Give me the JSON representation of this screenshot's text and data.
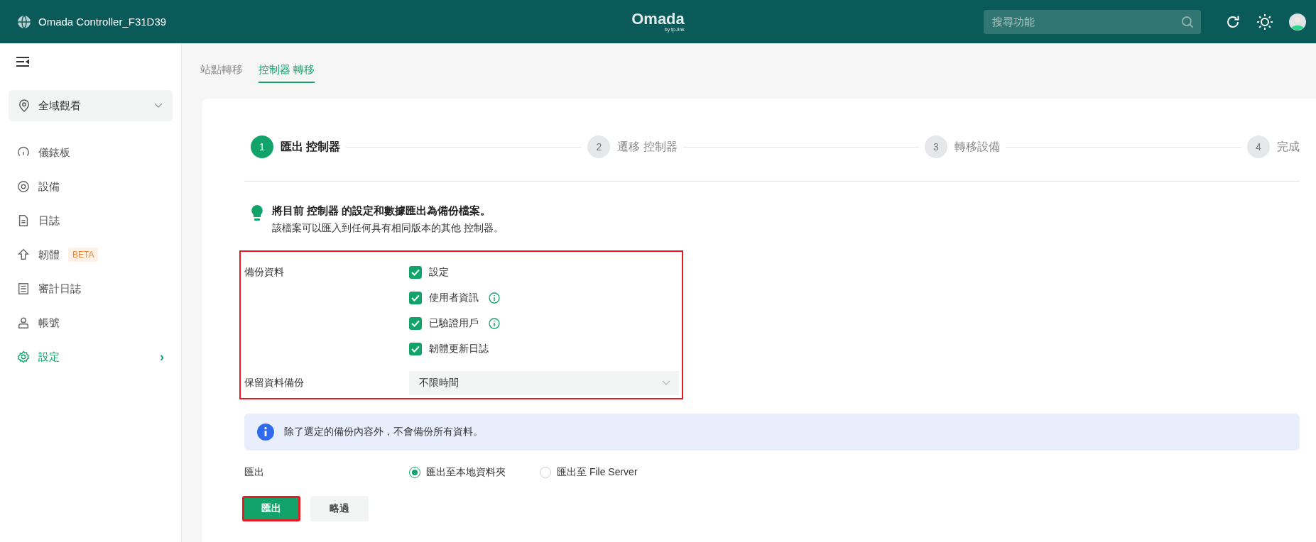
{
  "header": {
    "title": "Omada Controller_F31D39",
    "logo": "Omada",
    "logo_sub": "by tp-link",
    "search": {
      "placeholder": "搜尋功能"
    }
  },
  "sidebar": {
    "site_select": {
      "value": "全域觀看"
    },
    "items": [
      {
        "label": "儀錶板",
        "selected": false
      },
      {
        "label": "設備",
        "selected": false
      },
      {
        "label": "日誌",
        "selected": false
      },
      {
        "label": "韌體",
        "selected": false,
        "badge": "BETA"
      },
      {
        "label": "審計日誌",
        "selected": false
      },
      {
        "label": "帳號",
        "selected": false
      },
      {
        "label": "設定",
        "selected": true,
        "arrow": "›"
      }
    ]
  },
  "tabs": [
    {
      "label": "站點轉移",
      "selected": false
    },
    {
      "label": "控制器 轉移",
      "selected": true
    }
  ],
  "steps": [
    {
      "number": "1",
      "label": "匯出 控制器",
      "selected": true
    },
    {
      "number": "2",
      "label": "遷移 控制器",
      "selected": false
    },
    {
      "number": "3",
      "label": "轉移設備",
      "selected": false
    },
    {
      "number": "4",
      "label": "完成",
      "selected": false
    }
  ],
  "intro": {
    "title": "將目前 控制器 的設定和數據匯出為備份檔案。",
    "text": "該檔案可以匯入到任何具有相同版本的其他 控制器。"
  },
  "backup_section": {
    "highlighted": true,
    "label": "備份資料",
    "options": [
      {
        "label": "設定",
        "checked": true,
        "info": false
      },
      {
        "label": "使用者資訊",
        "checked": true,
        "info": true
      },
      {
        "label": "已驗證用戶",
        "checked": true,
        "info": true
      },
      {
        "label": "韌體更新日誌",
        "checked": true,
        "info": false
      }
    ],
    "retention_label": "保留資料備份",
    "retention": {
      "value": "不限時間"
    }
  },
  "notice": "除了選定的備份內容外，不會備份所有資料。",
  "export": {
    "label": "匯出",
    "options": [
      {
        "label": "匯出至本地資料夾",
        "selected": true
      },
      {
        "label": "匯出至 File Server",
        "selected": false
      }
    ]
  },
  "buttons": [
    {
      "label": "匯出",
      "kind": "primary",
      "highlighted": true
    },
    {
      "label": "略過",
      "kind": "secondary",
      "highlighted": false
    }
  ]
}
